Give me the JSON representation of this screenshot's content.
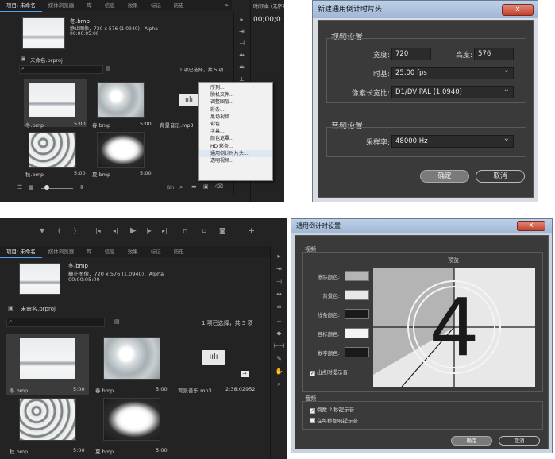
{
  "top_left": {
    "tabs": [
      "项目: 未命名",
      "媒体浏览器",
      "库",
      "信息",
      "效果",
      "标记",
      "历史"
    ],
    "clip_name": "冬.bmp",
    "clip_info": "静止图像，720 x 576 (1.0940)，Alpha",
    "clip_duration": "00:00:05:00",
    "project_file": "未命名.prproj",
    "selection_status": "1 项已选择，共 5 项",
    "items": [
      {
        "name": "冬.bmp",
        "duration": "5:00"
      },
      {
        "name": "春.bmp",
        "duration": "5:00"
      },
      {
        "name": "背景音乐.mp3",
        "duration": "5:00"
      },
      {
        "name": "秋.bmp",
        "duration": "5:00"
      },
      {
        "name": "夏.bmp",
        "duration": "5:00"
      }
    ],
    "timeline_tab": "时间轴: (无序列)",
    "timecode": "00;00;0",
    "bottom_right_label": "Bin"
  },
  "context_menu": {
    "items": [
      "序列...",
      "脱机文件...",
      "调整图层...",
      "彩条...",
      "黑场视频...",
      "彩色...",
      "字幕...",
      "颜色遮罩...",
      "HD 彩条...",
      "通用倒计时片头...",
      "透明视频..."
    ],
    "highlighted_index": 9
  },
  "new_countdown_dialog": {
    "title": "新建通用倒计时片头",
    "close": "x",
    "video_group": "视频设置",
    "width_label": "宽度:",
    "width_value": "720",
    "height_label": "高度:",
    "height_value": "576",
    "timebase_label": "时基:",
    "timebase_value": "25.00 fps",
    "par_label": "像素长宽比:",
    "par_value": "D1/DV PAL (1.0940)",
    "audio_group": "音频设置",
    "samplerate_label": "采样率:",
    "samplerate_value": "48000 Hz",
    "ok": "确定",
    "cancel": "取消"
  },
  "bottom_left": {
    "tabs": [
      "项目: 未命名",
      "媒体浏览器",
      "库",
      "信息",
      "效果",
      "标记",
      "历史"
    ],
    "clip_name": "冬.bmp",
    "clip_info": "静止图像，720 x 576 (1.0940)，Alpha",
    "clip_duration": "00:00:05:00",
    "project_file": "未命名.prproj",
    "selection_status": "1 项已选择，共 5 项",
    "items": [
      {
        "name": "冬.bmp",
        "duration": "5:00"
      },
      {
        "name": "春.bmp",
        "duration": "5:00"
      },
      {
        "name": "背景音乐.mp3",
        "duration": "2:38:02952"
      },
      {
        "name": "秋.bmp",
        "duration": "5:00"
      },
      {
        "name": "夏.bmp",
        "duration": "5:00"
      }
    ]
  },
  "countdown_settings_dialog": {
    "title": "通用倒计时设置",
    "close": "x",
    "video_group": "视频",
    "preview_label": "预览",
    "wipe_color_label": "擦除颜色:",
    "background_color_label": "背景色:",
    "line_color_label": "线条颜色:",
    "target_color_label": "目标颜色:",
    "number_color_label": "数字颜色:",
    "cue_at_out_label": "出点时提示音",
    "audio_group": "音频",
    "cue_2s_label": "倒数 2 秒提示音",
    "cue_each_second_label": "在每秒都响提示音",
    "preview_digit": "4",
    "ok": "确定",
    "cancel": "取消",
    "colors": {
      "wipe": "#b4b4b4",
      "background": "#e8e8e8",
      "line": "#1a1a1a",
      "target": "#f4f4f4",
      "number": "#1a1a1a"
    }
  }
}
